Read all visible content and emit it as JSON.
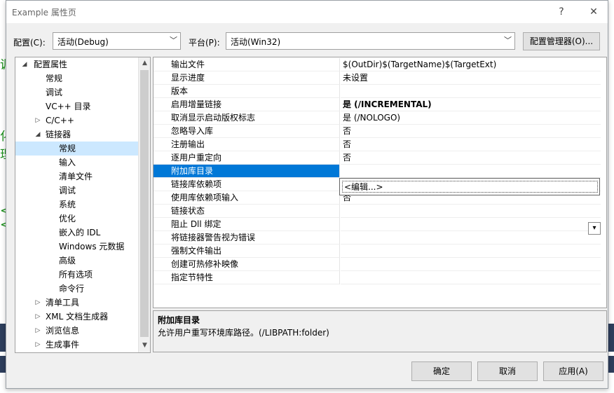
{
  "window": {
    "title": "Example 属性页",
    "help_glyph": "?",
    "close_glyph": "✕"
  },
  "config": {
    "label": "配置(C):",
    "value": "活动(Debug)",
    "platform_label": "平台(P):",
    "platform_value": "活动(Win32)",
    "manager_label": "配置管理器(O)..."
  },
  "tree": {
    "items": [
      {
        "label": "配置属性",
        "expander": "◢"
      },
      {
        "label": "常规"
      },
      {
        "label": "调试"
      },
      {
        "label": "VC++ 目录"
      },
      {
        "label": "C/C++",
        "expander": "▷"
      },
      {
        "label": "链接器",
        "expander": "◢"
      },
      {
        "label": "常规"
      },
      {
        "label": "输入"
      },
      {
        "label": "清单文件"
      },
      {
        "label": "调试"
      },
      {
        "label": "系统"
      },
      {
        "label": "优化"
      },
      {
        "label": "嵌入的 IDL"
      },
      {
        "label": "Windows 元数据"
      },
      {
        "label": "高级"
      },
      {
        "label": "所有选项"
      },
      {
        "label": "命令行"
      },
      {
        "label": "清单工具",
        "expander": "▷"
      },
      {
        "label": "XML 文档生成器",
        "expander": "▷"
      },
      {
        "label": "浏览信息",
        "expander": "▷"
      },
      {
        "label": "生成事件",
        "expander": "▷"
      }
    ],
    "selected_index": 6
  },
  "properties": [
    {
      "name": "输出文件",
      "value": "$(OutDir)$(TargetName)$(TargetExt)"
    },
    {
      "name": "显示进度",
      "value": "未设置"
    },
    {
      "name": "版本",
      "value": ""
    },
    {
      "name": "启用增量链接",
      "value": "是 (/INCREMENTAL)",
      "bold": true
    },
    {
      "name": "取消显示启动版权标志",
      "value": "是 (/NOLOGO)"
    },
    {
      "name": "忽略导入库",
      "value": "否"
    },
    {
      "name": "注册输出",
      "value": "否"
    },
    {
      "name": "逐用户重定向",
      "value": "否"
    },
    {
      "name": "附加库目录",
      "value": ""
    },
    {
      "name": "链接库依赖项",
      "value": ""
    },
    {
      "name": "使用库依赖项输入",
      "value": "否"
    },
    {
      "name": "链接状态",
      "value": ""
    },
    {
      "name": "阻止 Dll 绑定",
      "value": ""
    },
    {
      "name": "将链接器警告视为错误",
      "value": ""
    },
    {
      "name": "强制文件输出",
      "value": ""
    },
    {
      "name": "创建可热修补映像",
      "value": ""
    },
    {
      "name": "指定节特性",
      "value": ""
    }
  ],
  "selected_property_index": 8,
  "dropdown": {
    "item": "<编辑...>"
  },
  "description": {
    "title": "附加库目录",
    "text": "允许用户重写环境库路径。(/LIBPATH:folder)"
  },
  "buttons": {
    "ok": "确定",
    "cancel": "取消",
    "apply": "应用(A)"
  },
  "background_glyphs": [
    "调",
    "化",
    "理",
    "<",
    "<"
  ]
}
